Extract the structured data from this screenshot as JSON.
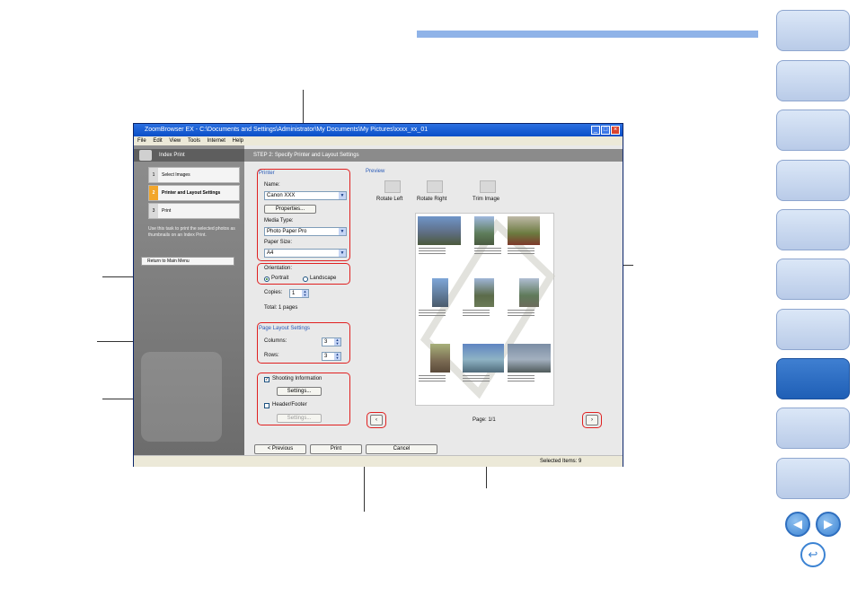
{
  "window": {
    "title": "ZoomBrowser EX  -  C:\\Documents and Settings\\Administrator\\My Documents\\My Pictures\\xxxx_xx_01",
    "menu": [
      "File",
      "Edit",
      "View",
      "Tools",
      "Internet",
      "Help"
    ]
  },
  "left_panel": {
    "title": "Index Print",
    "steps": [
      {
        "num": "1",
        "label": "Select Images"
      },
      {
        "num": "2",
        "label": "Printer and Layout Settings"
      },
      {
        "num": "3",
        "label": "Print"
      }
    ],
    "description": "Use this task to print the selected photos as thumbnails on an Index Print.",
    "return_label": "Return to Main Menu"
  },
  "step_header": "STEP 2: Specify Printer and Layout Settings",
  "printer": {
    "group_label": "Printer",
    "name_label": "Name:",
    "name_value": "Canon XXX",
    "properties_label": "Properties...",
    "media_label": "Media Type:",
    "media_value": "Photo Paper Pro",
    "size_label": "Paper Size:",
    "size_value": "A4"
  },
  "orientation": {
    "label": "Orientation:",
    "portrait": "Portrait",
    "landscape": "Landscape"
  },
  "copies": {
    "label": "Copies:",
    "value": "1"
  },
  "total": "Total: 1 pages",
  "layout": {
    "group_label": "Page Layout Settings",
    "columns_label": "Columns:",
    "columns_value": "3",
    "rows_label": "Rows:",
    "rows_value": "3"
  },
  "options": {
    "shooting_label": "Shooting Information",
    "settings_label": "Settings...",
    "header_label": "Header/Footer",
    "settings2_label": "Settings..."
  },
  "preview": {
    "group_label": "Preview",
    "rotate_left": "Rotate Left",
    "rotate_right": "Rotate Right",
    "trim": "Trim Image",
    "page_label": "Page: 1/1"
  },
  "buttons": {
    "previous": "< Previous",
    "print": "Print",
    "cancel": "Cancel"
  },
  "status": "Selected Items: 9",
  "colors": {
    "accent_blue": "#8fb3e8",
    "callout_red": "#e02020",
    "active_tab": "#1f5fb6"
  }
}
